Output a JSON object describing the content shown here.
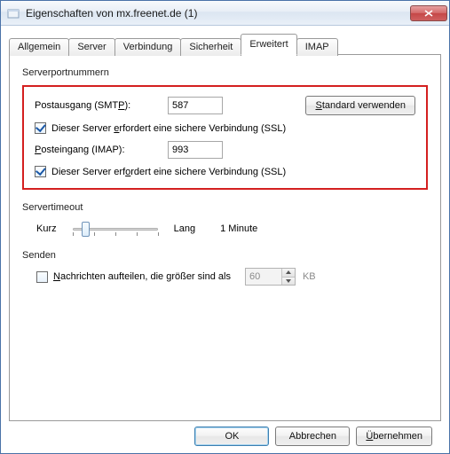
{
  "window": {
    "title": "Eigenschaften von mx.freenet.de (1)",
    "closeIcon": "close-icon"
  },
  "tabs": [
    {
      "label": "Allgemein"
    },
    {
      "label": "Server"
    },
    {
      "label": "Verbindung"
    },
    {
      "label": "Sicherheit"
    },
    {
      "label": "Erweitert"
    },
    {
      "label": "IMAP"
    }
  ],
  "activeTabIndex": 4,
  "ports": {
    "groupLabel": "Serverportnummern",
    "smtpLabel_p1": "Postausgang (SMT",
    "smtpLabel_u": "P",
    "smtpLabel_p2": "):",
    "smtpValue": "587",
    "defaultsBtn_u": "S",
    "defaultsBtn_rest": "tandard verwenden",
    "smtpSsl_p1": "Dieser Server ",
    "smtpSsl_u": "e",
    "smtpSsl_p2": "rfordert eine sichere Verbindung (SSL)",
    "smtpSslChecked": true,
    "imapLabel_u": "P",
    "imapLabel_rest": "osteingang (IMAP):",
    "imapValue": "993",
    "imapSsl_p1": "Dieser Server erf",
    "imapSsl_u": "o",
    "imapSsl_p2": "rdert eine sichere Verbindung (SSL)",
    "imapSslChecked": true
  },
  "timeout": {
    "groupLabel": "Servertimeout",
    "shortLabel": "Kurz",
    "longLabel": "Lang",
    "valueLabel": "1 Minute",
    "sliderPos": 0.14
  },
  "send": {
    "groupLabel": "Senden",
    "split_u": "N",
    "split_rest": "achrichten aufteilen, die größer sind als",
    "splitChecked": false,
    "sizeValue": "60",
    "unit": "KB"
  },
  "buttons": {
    "ok": "OK",
    "cancel": "Abbrechen",
    "apply_u": "Ü",
    "apply_rest": "bernehmen"
  }
}
